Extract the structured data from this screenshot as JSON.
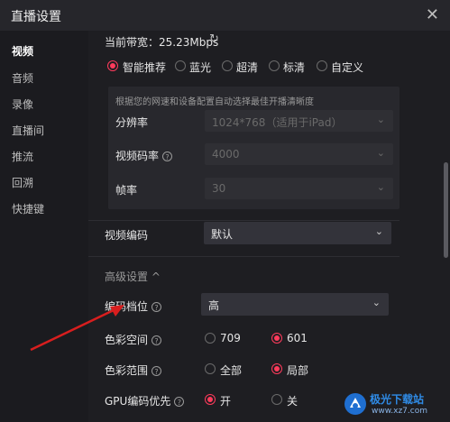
{
  "window": {
    "title": "直播设置",
    "close": "✕"
  },
  "sidebar": {
    "items": [
      "视频",
      "音频",
      "录像",
      "直播间",
      "推流",
      "回溯",
      "快捷键"
    ]
  },
  "bandwidth": {
    "label": "当前带宽：25.23Mbps",
    "refresh": "↻"
  },
  "quality": {
    "options": [
      "智能推荐",
      "蓝光",
      "超清",
      "标清",
      "自定义"
    ],
    "selected": "智能推荐",
    "hint": "根据您的网速和设备配置自动选择最佳开播清晰度"
  },
  "resolution": {
    "label": "分辨率",
    "value": "1024*768（适用于iPad）"
  },
  "bitrate": {
    "label": "视频码率",
    "value": "4000"
  },
  "framerate": {
    "label": "帧率",
    "value": "30"
  },
  "codec": {
    "label": "视频编码",
    "value": "默认"
  },
  "advanced": {
    "label": "高级设置",
    "caret": "^"
  },
  "profile": {
    "label": "编码档位",
    "value": "高"
  },
  "colorspace": {
    "label": "色彩空间",
    "options": [
      "709",
      "601"
    ],
    "selected": "601"
  },
  "colorrange": {
    "label": "色彩范围",
    "options": [
      "全部",
      "局部"
    ],
    "selected": "局部"
  },
  "gpu": {
    "label": "GPU编码优先",
    "options": [
      "开",
      "关"
    ],
    "selected": "开"
  },
  "icons": {
    "help": "?",
    "chevron": "⌄"
  },
  "watermark": {
    "name": "极光下载站",
    "url": "www.xz7.com"
  },
  "colors": {
    "accent": "#ff3b5c",
    "annotation": "#d81e1e"
  }
}
